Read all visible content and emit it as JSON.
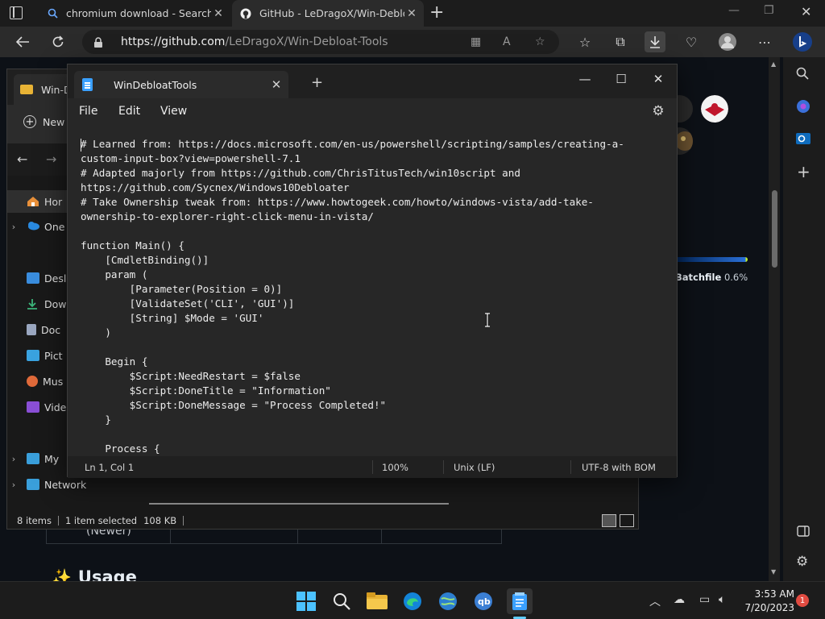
{
  "browser": {
    "tabs": [
      {
        "title": "chromium download - Search",
        "close": "✕"
      },
      {
        "title": "GitHub - LeDragoX/Win-Debloa",
        "close": "✕"
      }
    ],
    "new_tab": "+",
    "url_host": "https://github.com",
    "url_path": "/LeDragoX/Win-Debloat-Tools"
  },
  "github": {
    "language_label": "Batchfile",
    "language_pct": "0.6%",
    "table_cell": "(Newer)",
    "usage_heading": "Usage",
    "usage_emoji": "✨"
  },
  "explorer": {
    "tab_title": "Win-D",
    "new_label": "New",
    "nav": [
      {
        "label": "Hor",
        "chevron": ""
      },
      {
        "label": "One",
        "chevron": "›"
      },
      {
        "label": "Desl",
        "chevron": ""
      },
      {
        "label": "Dow",
        "chevron": ""
      },
      {
        "label": "Doc",
        "chevron": ""
      },
      {
        "label": "Pict",
        "chevron": ""
      },
      {
        "label": "Mus",
        "chevron": ""
      },
      {
        "label": "Vide",
        "chevron": ""
      },
      {
        "label": "My",
        "chevron": "›"
      },
      {
        "label": "Network",
        "chevron": "›"
      }
    ],
    "status": {
      "items": "8 items",
      "selected": "1 item selected",
      "size": "108 KB"
    }
  },
  "notepad": {
    "tab_title": "WinDebloatTools",
    "tab_close": "✕",
    "new_tab": "+",
    "window_controls": {
      "minimize": "—",
      "maximize": "☐",
      "close": "✕"
    },
    "menu": {
      "file": "File",
      "edit": "Edit",
      "view": "View"
    },
    "content": "# Learned from: https://docs.microsoft.com/en-us/powershell/scripting/samples/creating-a-\ncustom-input-box?view=powershell-7.1\n# Adapted majorly from https://github.com/ChrisTitusTech/win10script and\nhttps://github.com/Sycnex/Windows10Debloater\n# Take Ownership tweak from: https://www.howtogeek.com/howto/windows-vista/add-take-\nownership-to-explorer-right-click-menu-in-vista/\n\nfunction Main() {\n    [CmdletBinding()]\n    param (\n        [Parameter(Position = 0)]\n        [ValidateSet('CLI', 'GUI')]\n        [String] $Mode = 'GUI'\n    )\n\n    Begin {\n        $Script:NeedRestart = $false\n        $Script:DoneTitle = \"Information\"\n        $Script:DoneMessage = \"Process Completed!\"\n    }\n\n    Process {",
    "status": {
      "position": "Ln 1, Col 1",
      "zoom": "100%",
      "line_ending": "Unix (LF)",
      "encoding": "UTF-8 with BOM"
    }
  },
  "taskbar": {
    "time": "3:53 AM",
    "date": "7/20/2023",
    "notification_count": "1"
  },
  "colors": {
    "accent": "#60cdff",
    "notepad_icon": "#3aa0ff",
    "folder": "#e8b335",
    "badge": "#e14b41"
  }
}
